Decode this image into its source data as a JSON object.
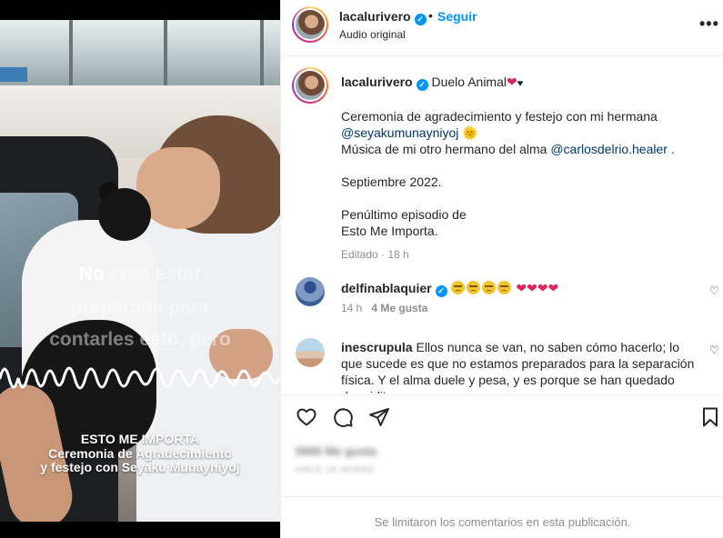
{
  "header": {
    "username": "lacalurivero",
    "verified_mark": "✓",
    "dot": "•",
    "follow_label": "Seguir",
    "audio_label": "Audio original",
    "more_icon": "more-horizontal-icon",
    "more_glyph": "•••"
  },
  "media": {
    "overlay_lines": [
      {
        "highlight": "No",
        "rest": " creo estar"
      },
      {
        "highlight": "",
        "rest": "preparada para"
      },
      {
        "highlight": "",
        "rest": "contarles esto, pero"
      }
    ],
    "caption_lines": [
      "ESTO ME IMPORTA",
      "Ceremonia de Agradecimiento",
      "y festejo con Seyaku Munayniyoj"
    ]
  },
  "caption": {
    "username": "lacalurivero",
    "title": "Duelo Animal",
    "line1": "Ceremonia de agradecimiento y festejo con mi hermana",
    "mention1": "@seyakumunayniyoj",
    "sun_emoji": "🌞",
    "line2_prefix": "Música de mi otro hermano del alma ",
    "mention2": "@carlosdelrio.healer",
    "line2_suffix": " .",
    "line3": "Septiembre 2022.",
    "line4": "Penúltimo episodio de",
    "line5": "Esto Me Importa.",
    "edited": "Editado",
    "time": "18 h",
    "red_heart": "❤",
    "black_heart": "♥"
  },
  "comments": [
    {
      "username": "delfinablaquier",
      "sad_count": 4,
      "hearts": "❤❤❤❤",
      "time": "14 h",
      "likes": "4 Me gusta",
      "like_glyph": "♡"
    },
    {
      "username": "inescrupula",
      "text": "Ellos nunca se van, no saben cómo hacerlo; lo que sucede es que no estamos preparados para la separación física. Y el alma duele y pesa, y es porque se han quedado dormiditos",
      "like_glyph": "♡"
    }
  ],
  "actions": {
    "icons": [
      "heart-icon",
      "comment-icon",
      "share-icon",
      "bookmark-icon"
    ],
    "likes_text": "5685 Me gusta",
    "date_text": "HACE 18 HORAS"
  },
  "footer": {
    "text": "Se limitaron los comentarios en esta publicación."
  },
  "colors": {
    "accent": "#0095f6",
    "mention": "#00376b",
    "muted": "#8e8e8e",
    "heart_red": "#e0245e"
  }
}
